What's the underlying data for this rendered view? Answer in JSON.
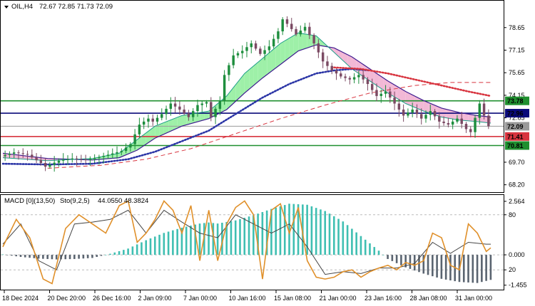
{
  "header": {
    "symbol_label": "OIL,H4",
    "ohlc_label": "72.67 72.85 71.73 72.09"
  },
  "indicator_header": {
    "macd_label": "MACD [0](13,50)",
    "stoch_label": "Sto(9,2,5)",
    "values_label": "44.0550 48.3824"
  },
  "colors": {
    "bull_candle": "#1e8e3e",
    "bear_candle": "#7b4a63",
    "fast_ma": "#1f9e89",
    "slow_ma": "#3c1a8e",
    "cloud_up": "#9ef0a8",
    "cloud_down": "#f2b8d6",
    "dotted_blue": "#2b35a6",
    "dotted_red": "#d8343f",
    "dashed_red": "#d8343f",
    "line_green": "#1f8f2f",
    "line_navy": "#0a0a7a",
    "line_red": "#d8343f",
    "line_gray": "#9a9a9a",
    "macd_hist": "#3fbfb2",
    "macd_hist_neg": "#5a6470",
    "stoch_main": "#e0902a",
    "stoch_signal": "#444444"
  },
  "chart_data": [
    {
      "type": "candlestick",
      "title": "OIL,H4",
      "y_ticks": [
        "78.65",
        "77.15",
        "75.65",
        "74.15",
        "72.65",
        "69.70",
        "68.20"
      ],
      "ylim": [
        67.9,
        80.2
      ],
      "x_labels": [
        "18 Dec 2024",
        "20 Dec 20:00",
        "26 Dec 16:00",
        "2 Jan 09:00",
        "7 Jan 00:00",
        "10 Jan 16:00",
        "15 Jan 08:00",
        "21 Jan 00:00",
        "23 Jan 16:00",
        "28 Jan 08:00",
        "31 Jan 00:00"
      ],
      "levels": [
        {
          "value": 73.78,
          "label": "73.78",
          "color": "#1f8f2f",
          "style": "solid"
        },
        {
          "value": 72.96,
          "label": "72.96",
          "color": "#0a0a7a",
          "style": "solid"
        },
        {
          "value": 72.09,
          "label": "72.09",
          "color": "#9a9a9a",
          "style": "solid"
        },
        {
          "value": 71.41,
          "label": "71.41",
          "color": "#d8343f",
          "style": "solid"
        },
        {
          "value": 70.81,
          "label": "70.81",
          "color": "#1f8f2f",
          "style": "solid"
        }
      ],
      "price_path": [
        [
          0,
          70.1
        ],
        [
          3,
          70.35
        ],
        [
          6,
          70.2
        ],
        [
          9,
          69.65
        ],
        [
          10,
          69.4
        ],
        [
          13,
          69.8
        ],
        [
          16,
          69.95
        ],
        [
          19,
          69.85
        ],
        [
          22,
          70.05
        ],
        [
          24,
          70.2
        ],
        [
          27,
          70.45
        ],
        [
          29,
          70.9
        ],
        [
          31,
          72.2
        ],
        [
          33,
          72.6
        ],
        [
          34,
          72.4
        ],
        [
          36,
          72.9
        ],
        [
          38,
          73.6
        ],
        [
          40,
          73.2
        ],
        [
          42,
          72.7
        ],
        [
          44,
          73.5
        ],
        [
          46,
          73.7
        ],
        [
          47,
          72.7
        ],
        [
          49,
          73.8
        ],
        [
          50,
          75.5
        ],
        [
          52,
          76.8
        ],
        [
          54,
          77.1
        ],
        [
          56,
          77.6
        ],
        [
          58,
          76.9
        ],
        [
          60,
          77.4
        ],
        [
          62,
          78.4
        ],
        [
          63,
          79.2
        ],
        [
          64,
          78.9
        ],
        [
          66,
          78.2
        ],
        [
          68,
          78.7
        ],
        [
          70,
          77.6
        ],
        [
          72,
          76.4
        ],
        [
          74,
          75.8
        ],
        [
          76,
          75.4
        ],
        [
          78,
          75.2
        ],
        [
          80,
          75.5
        ],
        [
          82,
          74.9
        ],
        [
          84,
          74.1
        ],
        [
          86,
          74.4
        ],
        [
          88,
          73.6
        ],
        [
          90,
          72.8
        ],
        [
          92,
          73.2
        ],
        [
          94,
          72.6
        ],
        [
          96,
          73.1
        ],
        [
          98,
          72.4
        ],
        [
          100,
          72.2
        ],
        [
          102,
          72.6
        ],
        [
          104,
          71.9
        ],
        [
          105,
          71.7
        ],
        [
          107,
          73.6
        ],
        [
          108,
          72.8
        ],
        [
          109,
          72.09
        ]
      ],
      "fast_ma_path": [
        [
          0,
          70.0
        ],
        [
          10,
          69.8
        ],
        [
          20,
          69.95
        ],
        [
          26,
          70.3
        ],
        [
          30,
          71.2
        ],
        [
          34,
          72.1
        ],
        [
          40,
          72.8
        ],
        [
          46,
          73.1
        ],
        [
          50,
          74.1
        ],
        [
          54,
          75.6
        ],
        [
          58,
          76.6
        ],
        [
          62,
          77.6
        ],
        [
          66,
          78.3
        ],
        [
          70,
          78.1
        ],
        [
          74,
          77.0
        ],
        [
          78,
          75.9
        ],
        [
          82,
          75.1
        ],
        [
          86,
          74.3
        ],
        [
          90,
          73.6
        ],
        [
          94,
          73.1
        ],
        [
          98,
          72.7
        ],
        [
          102,
          72.5
        ],
        [
          106,
          72.4
        ],
        [
          109,
          72.3
        ]
      ],
      "slow_ma_path": [
        [
          0,
          70.3
        ],
        [
          10,
          69.95
        ],
        [
          20,
          69.85
        ],
        [
          26,
          70.0
        ],
        [
          30,
          70.5
        ],
        [
          34,
          71.3
        ],
        [
          40,
          72.1
        ],
        [
          46,
          72.6
        ],
        [
          50,
          73.2
        ],
        [
          54,
          74.3
        ],
        [
          58,
          75.3
        ],
        [
          62,
          76.2
        ],
        [
          66,
          77.1
        ],
        [
          70,
          77.5
        ],
        [
          74,
          77.3
        ],
        [
          78,
          76.7
        ],
        [
          82,
          75.9
        ],
        [
          86,
          75.1
        ],
        [
          90,
          74.4
        ],
        [
          94,
          73.8
        ],
        [
          98,
          73.3
        ],
        [
          102,
          73.0
        ],
        [
          106,
          72.8
        ],
        [
          109,
          72.7
        ]
      ],
      "dotted_blue_path": [
        [
          0,
          69.6
        ],
        [
          10,
          69.55
        ],
        [
          20,
          69.6
        ],
        [
          28,
          69.9
        ],
        [
          34,
          70.4
        ],
        [
          40,
          71.1
        ],
        [
          46,
          71.8
        ],
        [
          52,
          72.9
        ],
        [
          58,
          74.0
        ],
        [
          64,
          74.9
        ],
        [
          70,
          75.6
        ],
        [
          74,
          75.8
        ],
        [
          78,
          75.9
        ],
        [
          82,
          75.8
        ]
      ],
      "dotted_red_path": [
        [
          74,
          76.0
        ],
        [
          80,
          75.9
        ],
        [
          86,
          75.6
        ],
        [
          92,
          75.2
        ],
        [
          98,
          74.8
        ],
        [
          104,
          74.4
        ],
        [
          109,
          74.1
        ]
      ],
      "dashed_red_path": [
        [
          10,
          69.3
        ],
        [
          22,
          69.5
        ],
        [
          32,
          69.9
        ],
        [
          42,
          70.6
        ],
        [
          52,
          71.6
        ],
        [
          62,
          72.6
        ],
        [
          72,
          73.5
        ],
        [
          82,
          74.3
        ],
        [
          92,
          74.8
        ],
        [
          100,
          75.0
        ],
        [
          109,
          75.0
        ]
      ]
    },
    {
      "type": "bar+line",
      "title": "MACD [0](13,50) Sto(9,2,5)",
      "y_ticks": [
        "2.564",
        "80",
        "0.000",
        "20",
        "-1.455"
      ],
      "ylim": [
        -1.6,
        2.8
      ],
      "macd_histogram": [
        [
          0,
          0.02
        ],
        [
          4,
          -0.1
        ],
        [
          8,
          -0.18
        ],
        [
          12,
          -0.22
        ],
        [
          16,
          -0.2
        ],
        [
          20,
          -0.15
        ],
        [
          24,
          0.05
        ],
        [
          28,
          0.3
        ],
        [
          32,
          0.7
        ],
        [
          36,
          1.05
        ],
        [
          40,
          1.3
        ],
        [
          44,
          1.5
        ],
        [
          46,
          1.55
        ],
        [
          48,
          1.5
        ],
        [
          52,
          1.65
        ],
        [
          56,
          1.9
        ],
        [
          60,
          2.2
        ],
        [
          64,
          2.45
        ],
        [
          68,
          2.4
        ],
        [
          72,
          2.1
        ],
        [
          76,
          1.6
        ],
        [
          80,
          0.9
        ],
        [
          84,
          0.2
        ],
        [
          86,
          -0.2
        ],
        [
          90,
          -0.6
        ],
        [
          94,
          -0.9
        ],
        [
          98,
          -1.15
        ],
        [
          102,
          -1.3
        ],
        [
          106,
          -1.35
        ],
        [
          109,
          -1.2
        ]
      ],
      "stoch_main": [
        [
          0,
          45
        ],
        [
          3,
          75
        ],
        [
          6,
          55
        ],
        [
          9,
          10
        ],
        [
          11,
          5
        ],
        [
          14,
          65
        ],
        [
          17,
          80
        ],
        [
          20,
          70
        ],
        [
          23,
          60
        ],
        [
          26,
          90
        ],
        [
          28,
          95
        ],
        [
          30,
          50
        ],
        [
          32,
          60
        ],
        [
          34,
          75
        ],
        [
          36,
          95
        ],
        [
          38,
          85
        ],
        [
          40,
          60
        ],
        [
          42,
          90
        ],
        [
          44,
          30
        ],
        [
          46,
          85
        ],
        [
          48,
          30
        ],
        [
          50,
          70
        ],
        [
          52,
          88
        ],
        [
          54,
          95
        ],
        [
          56,
          80
        ],
        [
          58,
          10
        ],
        [
          60,
          85
        ],
        [
          62,
          92
        ],
        [
          64,
          60
        ],
        [
          66,
          88
        ],
        [
          68,
          30
        ],
        [
          70,
          12
        ],
        [
          72,
          10
        ],
        [
          74,
          12
        ],
        [
          76,
          18
        ],
        [
          78,
          20
        ],
        [
          80,
          12
        ],
        [
          82,
          18
        ],
        [
          84,
          22
        ],
        [
          86,
          25
        ],
        [
          88,
          20
        ],
        [
          90,
          28
        ],
        [
          92,
          25
        ],
        [
          94,
          30
        ],
        [
          96,
          60
        ],
        [
          98,
          55
        ],
        [
          100,
          25
        ],
        [
          102,
          20
        ],
        [
          104,
          70
        ],
        [
          106,
          60
        ],
        [
          108,
          40
        ],
        [
          109,
          44
        ]
      ],
      "stoch_signal": [
        [
          0,
          48
        ],
        [
          4,
          70
        ],
        [
          8,
          30
        ],
        [
          12,
          20
        ],
        [
          16,
          70
        ],
        [
          20,
          72
        ],
        [
          24,
          75
        ],
        [
          28,
          85
        ],
        [
          32,
          60
        ],
        [
          36,
          85
        ],
        [
          40,
          72
        ],
        [
          44,
          60
        ],
        [
          48,
          55
        ],
        [
          52,
          80
        ],
        [
          56,
          70
        ],
        [
          60,
          60
        ],
        [
          64,
          70
        ],
        [
          68,
          45
        ],
        [
          72,
          15
        ],
        [
          76,
          18
        ],
        [
          80,
          16
        ],
        [
          84,
          22
        ],
        [
          88,
          22
        ],
        [
          92,
          27
        ],
        [
          96,
          50
        ],
        [
          100,
          38
        ],
        [
          104,
          50
        ],
        [
          108,
          48
        ],
        [
          109,
          48
        ]
      ]
    }
  ]
}
